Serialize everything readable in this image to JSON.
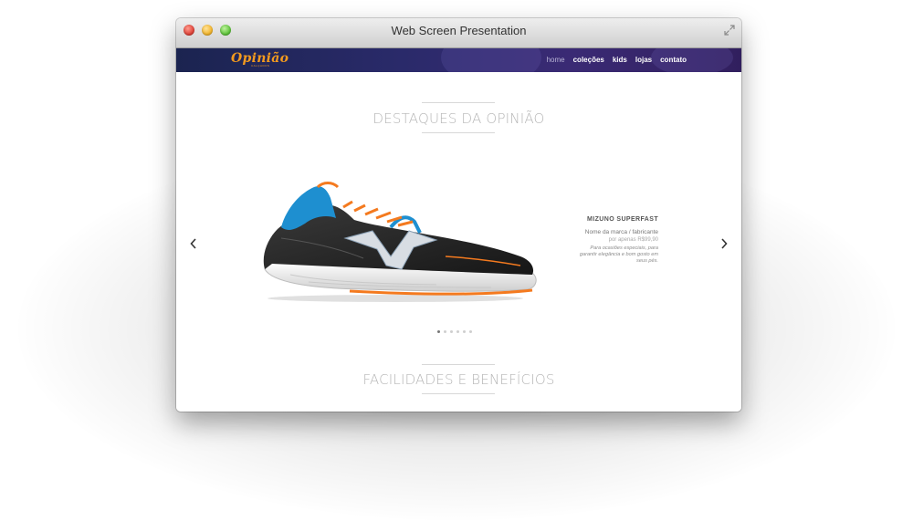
{
  "window": {
    "title": "Web Screen Presentation"
  },
  "nav": {
    "logo": "Opinião",
    "logo_sub": "CALÇADOS",
    "items": [
      {
        "label": "home",
        "active": true
      },
      {
        "label": "coleções",
        "active": false
      },
      {
        "label": "kids",
        "active": false
      },
      {
        "label": "lojas",
        "active": false
      },
      {
        "label": "contato",
        "active": false
      }
    ]
  },
  "sections": {
    "highlights_title": "DESTAQUES DA OPINIÃO",
    "benefits_title": "FACILIDADES E BENEFÍCIOS"
  },
  "product": {
    "name": "MIZUNO SUPERFAST",
    "brand": "Nome da marca / fabricante",
    "price": "por apenas R$99,90",
    "description": "Para ocasiões especiais, para garantir elegância e bom gosto em seus pés."
  },
  "carousel": {
    "slide_count": 6,
    "active_index": 0
  },
  "colors": {
    "accent_orange": "#f39a1e",
    "nav_bg": "#2a2a6a",
    "shoe_blue": "#1e8fd0",
    "shoe_orange": "#f47a1f"
  },
  "icons": [
    "expand-icon",
    "chevron-left-icon",
    "chevron-right-icon"
  ]
}
